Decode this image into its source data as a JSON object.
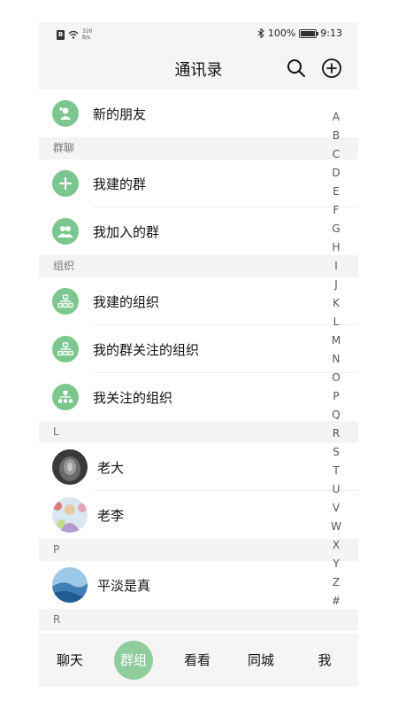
{
  "statusbar": {
    "net_speed_value": "320",
    "net_speed_unit": "B/s",
    "battery_percent": "100%",
    "time": "9:13",
    "battery_level": 1.0
  },
  "header": {
    "title": "通讯录",
    "icons": [
      "search-icon",
      "add-circle-icon"
    ]
  },
  "rows": {
    "new_friends": "新的朋友",
    "my_groups": "我建的群",
    "joined_groups": "我加入的群",
    "my_orgs": "我建的组织",
    "group_followed_orgs": "我的群关注的组织",
    "followed_orgs": "我关注的组织",
    "contact_laoda": "老大",
    "contact_laoli": "老李",
    "contact_pingdan": "平淡是真"
  },
  "sections": {
    "group_chat": "群聊",
    "organizations": "组织",
    "letter_l": "L",
    "letter_p": "P",
    "letter_r": "R"
  },
  "index_letters": [
    "A",
    "B",
    "C",
    "D",
    "E",
    "F",
    "G",
    "H",
    "I",
    "J",
    "K",
    "L",
    "M",
    "N",
    "O",
    "P",
    "Q",
    "R",
    "S",
    "T",
    "U",
    "V",
    "W",
    "X",
    "Y",
    "Z",
    "#"
  ],
  "tabs": {
    "chat": "聊天",
    "groups": "群组",
    "watch": "看看",
    "city": "同城",
    "me": "我"
  },
  "colors": {
    "accent_green": "#7cc68f",
    "active_tab": "#8fcd9d"
  }
}
